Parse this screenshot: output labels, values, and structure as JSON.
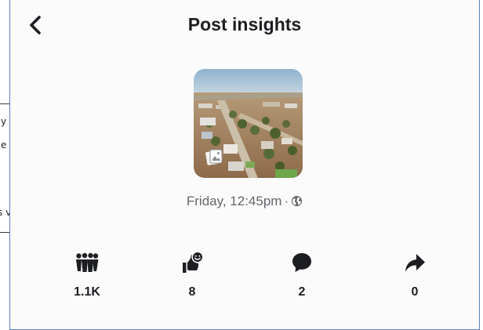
{
  "background_doc": {
    "fragments": [
      "y",
      "e",
      "s v"
    ]
  },
  "header": {
    "title": "Post insights",
    "back_icon": "chevron-left-icon"
  },
  "post": {
    "thumbnail_icon": "photo-album-icon",
    "timestamp": "Friday, 12:45pm",
    "separator": "·",
    "audience_icon": "globe-icon"
  },
  "stats": [
    {
      "icon": "reach-crowd-icon",
      "value": "1.1K"
    },
    {
      "icon": "reactions-icon",
      "value": "8"
    },
    {
      "icon": "comment-bubble-icon",
      "value": "2"
    },
    {
      "icon": "share-arrow-icon",
      "value": "0"
    }
  ],
  "colors": {
    "text_primary": "#1c1e21",
    "text_secondary": "#65676b",
    "panel_border": "#5b7fc7",
    "panel_bg": "#fbfbfc"
  }
}
